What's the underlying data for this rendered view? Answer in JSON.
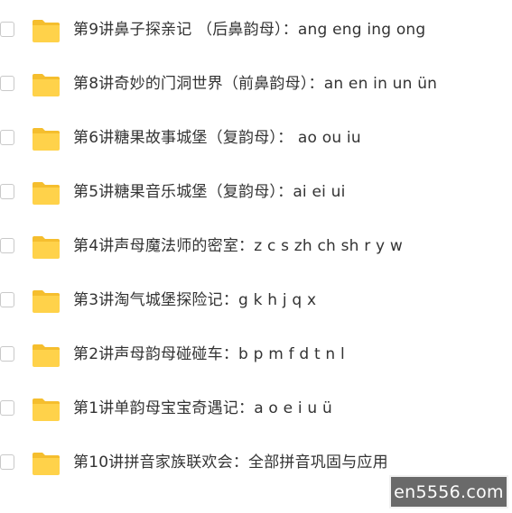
{
  "files": [
    {
      "name": "第9讲鼻子探亲记 （后鼻韵母）：ang eng ing ong",
      "icon": "folder-icon"
    },
    {
      "name": "第8讲奇妙的门洞世界（前鼻韵母）：an en in un ün",
      "icon": "folder-icon"
    },
    {
      "name": "第6讲糖果故事城堡（复韵母）： ao ou iu",
      "icon": "folder-icon"
    },
    {
      "name": "第5讲糖果音乐城堡（复韵母）：ai ei ui",
      "icon": "folder-icon"
    },
    {
      "name": "第4讲声母魔法师的密室：z c s zh ch sh r y w",
      "icon": "folder-icon"
    },
    {
      "name": "第3讲淘气城堡探险记：g k h j q x",
      "icon": "folder-icon"
    },
    {
      "name": "第2讲声母韵母碰碰车：b p m f d t n l",
      "icon": "folder-icon"
    },
    {
      "name": "第1讲单韵母宝宝奇遇记：a o e i u ü",
      "icon": "folder-icon"
    },
    {
      "name": "第10讲拼音家族联欢会：全部拼音巩固与应用",
      "icon": "folder-icon"
    }
  ],
  "watermark": "en5556.com",
  "colors": {
    "folder_body": "#FFD24A",
    "folder_tab": "#F5BE2E",
    "text": "#333333",
    "watermark_bg": "#6A6A6A"
  }
}
